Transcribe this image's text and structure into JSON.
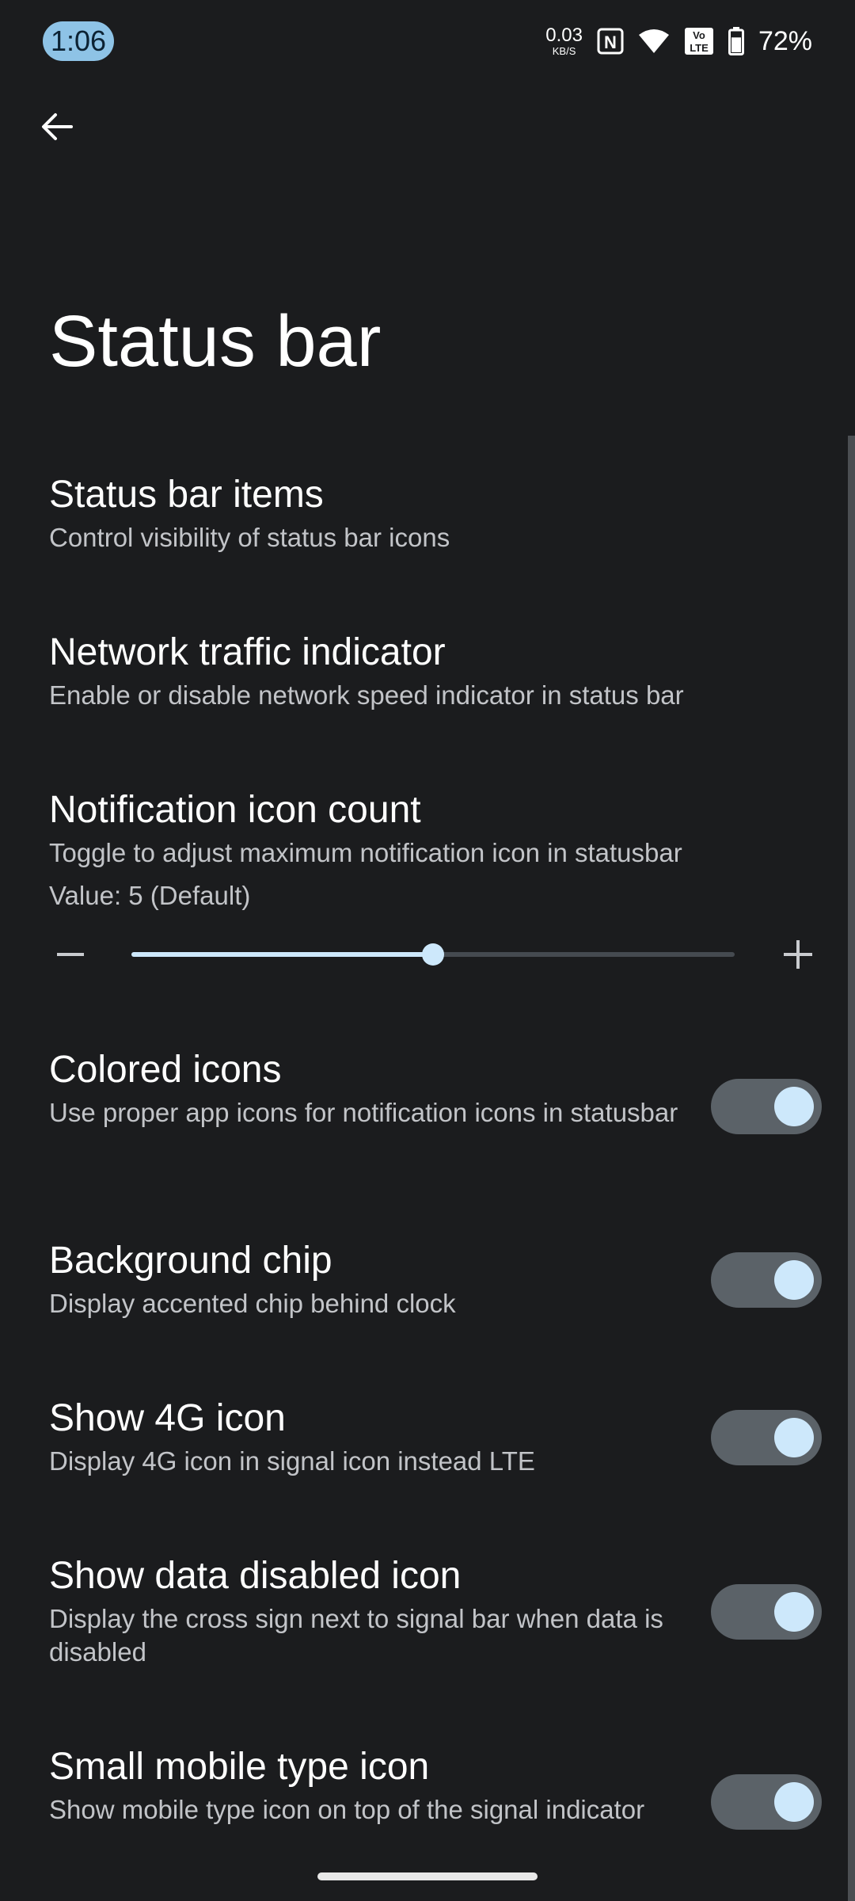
{
  "status_bar": {
    "time": "1:06",
    "net_speed_value": "0.03",
    "net_speed_unit": "KB/S",
    "icons": [
      "nfc-icon",
      "wifi-icon",
      "volte-icon",
      "battery-icon"
    ],
    "volte_label_top": "Vo",
    "volte_label_bottom": "LTE",
    "nfc_label": "N",
    "battery_percent": "72%",
    "battery_level": 0.72
  },
  "header": {
    "back_icon": "arrow-back-icon",
    "title": "Status bar"
  },
  "preferences": [
    {
      "title": "Status bar items",
      "summary": "Control visibility of status bar icons"
    },
    {
      "title": "Network traffic indicator",
      "summary": "Enable or disable network speed indicator in status bar"
    },
    {
      "title": "Notification icon count",
      "summary": "Toggle to adjust maximum notification icon in statusbar",
      "value_text": "Value: 5  (Default)",
      "slider": {
        "min": 0,
        "max": 10,
        "value": 5
      }
    },
    {
      "title": "Colored icons",
      "summary": "Use proper app icons for notification icons in statusbar",
      "toggle": true
    },
    {
      "title": "Background chip",
      "summary": "Display accented chip behind clock",
      "toggle": true
    },
    {
      "title": "Show 4G icon",
      "summary": "Display 4G icon in signal icon instead LTE",
      "toggle": true
    },
    {
      "title": "Show data disabled icon",
      "summary": "Display the cross sign next to signal bar when data is disabled",
      "toggle": true
    },
    {
      "title": "Small mobile type icon",
      "summary": "Show mobile type icon on top of the signal indicator",
      "toggle": true
    }
  ],
  "colors": {
    "background": "#1b1c1e",
    "accent": "#cde8fb",
    "clock_chip": "#8ec3e6",
    "toggle_track": "#5b6268"
  }
}
